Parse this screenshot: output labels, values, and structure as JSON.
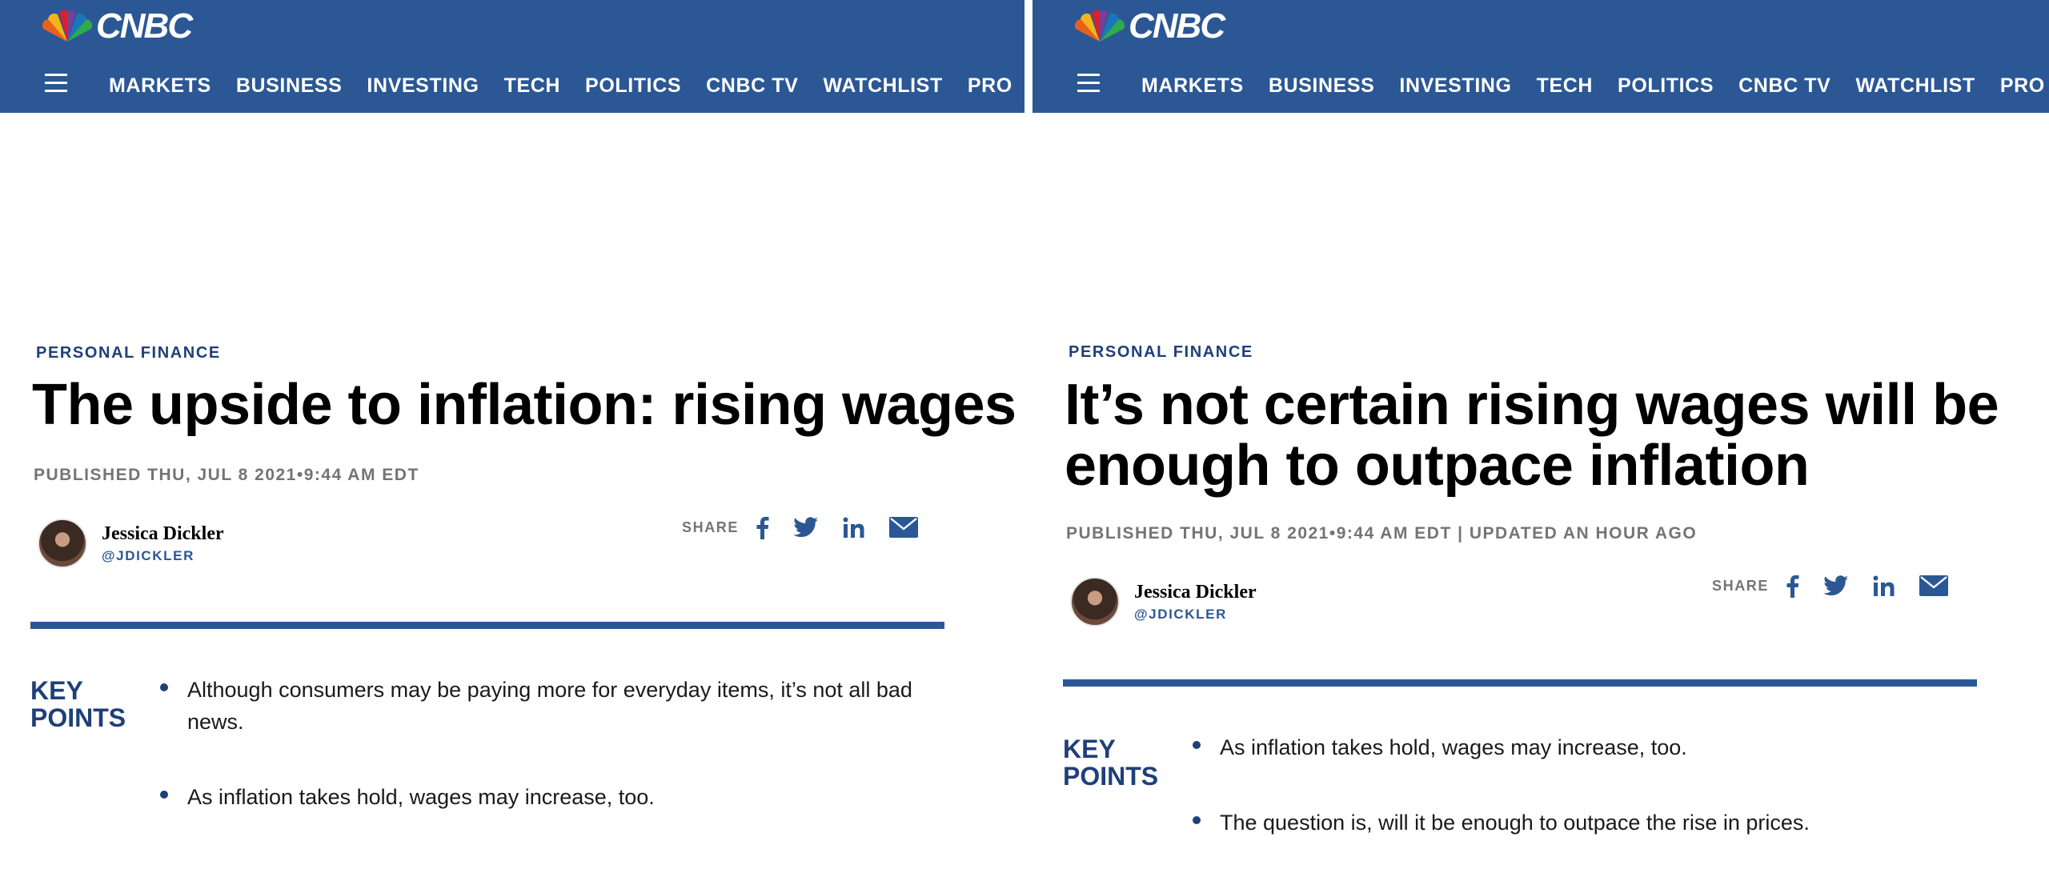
{
  "header": {
    "logo_text": "CNBC",
    "nav": [
      "MARKETS",
      "BUSINESS",
      "INVESTING",
      "TECH",
      "POLITICS",
      "CNBC TV",
      "WATCHLIST",
      "PRO"
    ]
  },
  "articles": [
    {
      "section": "PERSONAL FINANCE",
      "title": "The upside to inflation: rising wages",
      "published": "PUBLISHED THU, JUL 8 2021•9:44 AM EDT",
      "author_name": "Jessica Dickler",
      "author_handle": "@JDICKLER",
      "share_label": "SHARE",
      "key_points_label": "KEY POINTS",
      "key_points": [
        "Although consumers may be paying more for everyday items, it’s not all bad news.",
        "As inflation takes hold, wages may increase, too."
      ]
    },
    {
      "section": "PERSONAL FINANCE",
      "title": "It’s not certain rising wages will be enough to outpace inflation",
      "published": "PUBLISHED THU, JUL 8 2021•9:44 AM EDT | UPDATED AN HOUR AGO",
      "author_name": "Jessica Dickler",
      "author_handle": "@JDICKLER",
      "share_label": "SHARE",
      "key_points_label": "KEY POINTS",
      "key_points": [
        "As inflation takes hold, wages may increase, too.",
        "The question is, will it be enough to outpace the rise in prices."
      ]
    }
  ],
  "icons": {
    "share": [
      "facebook-icon",
      "twitter-icon",
      "linkedin-icon",
      "email-icon"
    ],
    "menu": "hamburger-menu-icon",
    "logo": "peacock-logo-icon"
  },
  "colors": {
    "brand_blue": "#2b5795",
    "label_blue": "#1f3f78",
    "meta_gray": "#747474"
  }
}
